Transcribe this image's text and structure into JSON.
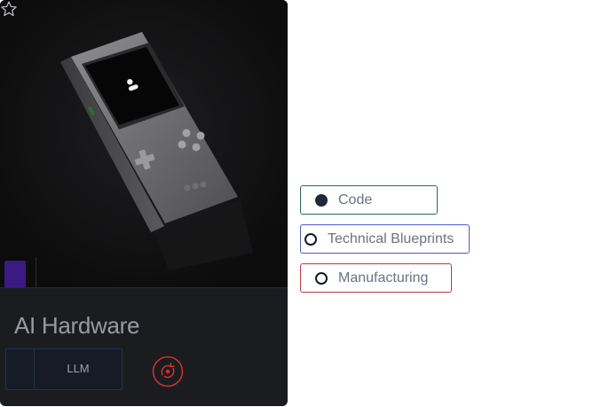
{
  "card": {
    "title": "AI Hardware",
    "tag_label": "LLM"
  },
  "options": [
    {
      "label": "Code",
      "selected": true
    },
    {
      "label": "Technical Blueprints",
      "selected": false
    },
    {
      "label": "Manufacturing",
      "selected": false
    }
  ],
  "colors": {
    "card_bg": "#1b1c20",
    "swatch": "#3b1b82",
    "option_code_border": "#2a6b5e",
    "option_blueprints_border": "#4f57d6",
    "option_manufacturing_border": "#c0393b",
    "action_icon": "#d0342c"
  },
  "icons": [
    "star-icon",
    "handheld-console-image",
    "ai-action-icon"
  ]
}
